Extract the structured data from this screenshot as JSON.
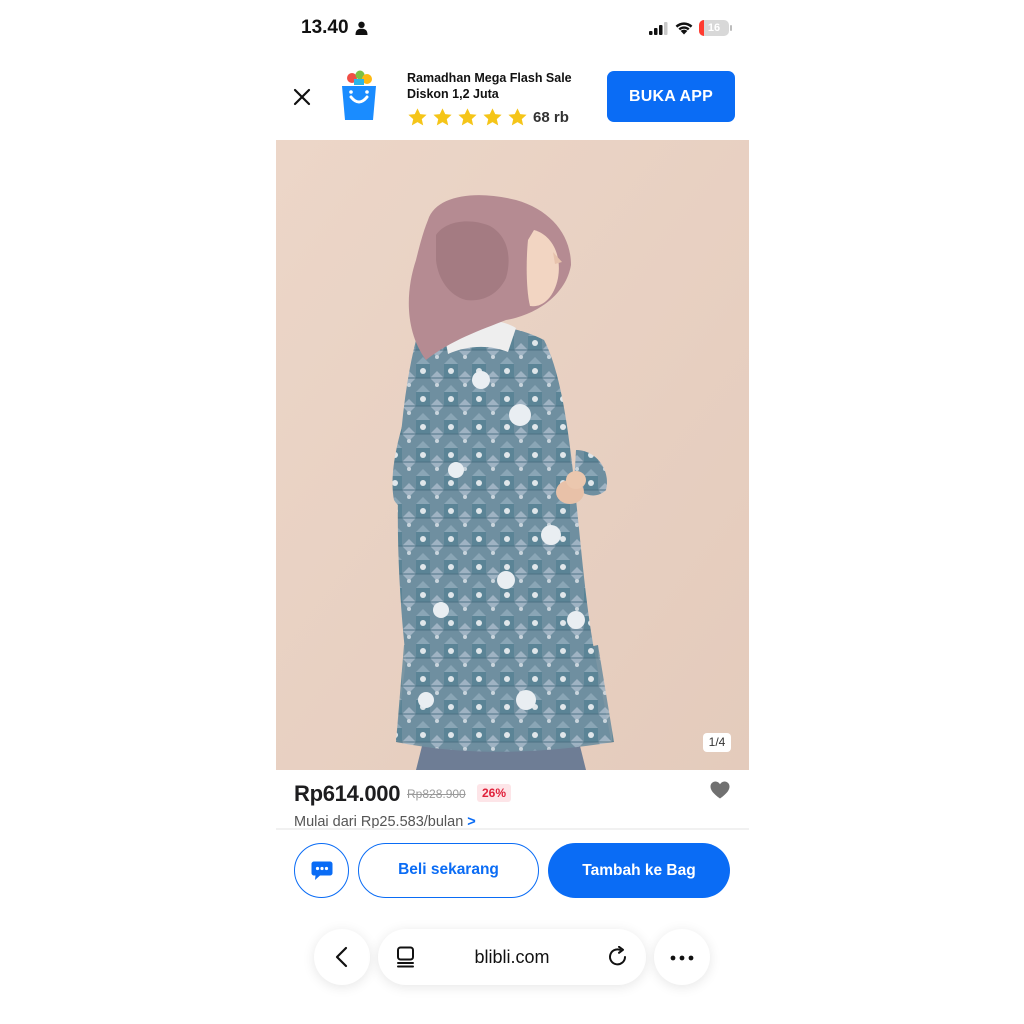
{
  "status_bar": {
    "time": "13.40",
    "battery_level": "16",
    "icons": [
      "person-icon",
      "signal-icon",
      "wifi-icon",
      "battery-icon"
    ]
  },
  "app_banner": {
    "close_icon": "close-icon",
    "logo_icon": "blibli-bag-icon",
    "promo_text": "Ramadhan Mega Flash Sale Diskon 1,2 Juta",
    "star_count": 5,
    "rating_count": "68 rb",
    "button_label": "BUKA APP"
  },
  "product": {
    "image_counter": "1/4",
    "price": "Rp614.000",
    "original_price": "Rp828.900",
    "discount": "26%",
    "installment": "Mulai dari Rp25.583/bulan",
    "installment_chevron": ">",
    "wishlist_icon": "heart-icon"
  },
  "actions": {
    "chat_icon": "chat-icon",
    "buy_now_label": "Beli sekarang",
    "add_to_bag_label": "Tambah ke Bag"
  },
  "browser": {
    "url": "blibli.com",
    "icons": [
      "back-chevron-icon",
      "tabs-icon",
      "reload-icon",
      "more-icon"
    ]
  },
  "colors": {
    "brand_blue": "#0a6cf5",
    "discount_red": "#e0203a",
    "discount_bg": "#fde5e8",
    "star_yellow": "#f5c518",
    "image_background": "#e9d3c5"
  }
}
